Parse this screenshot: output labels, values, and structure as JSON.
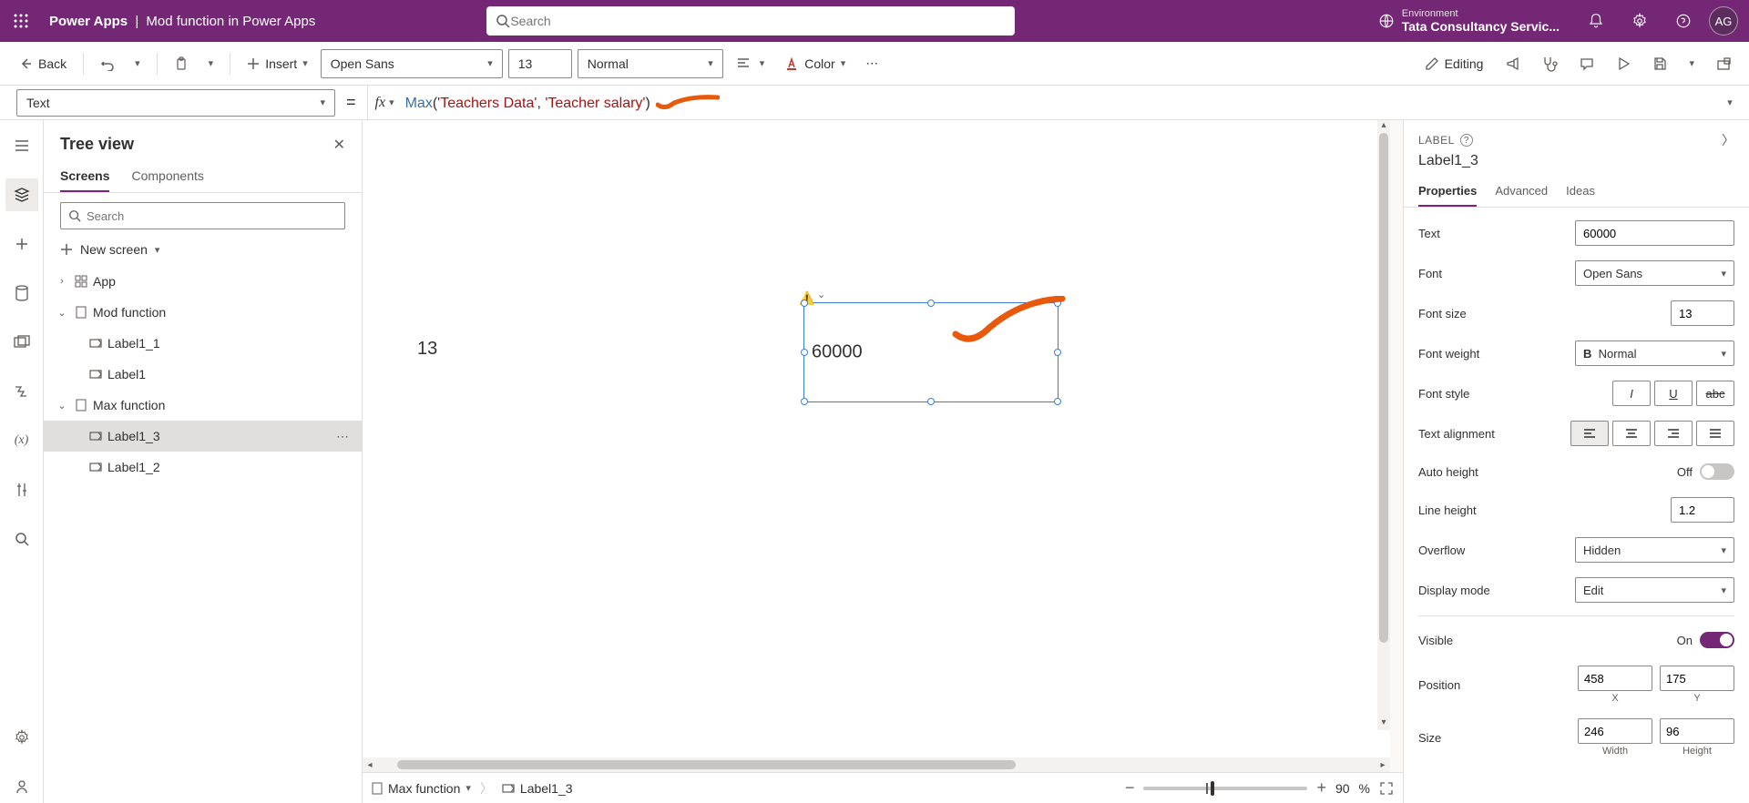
{
  "header": {
    "app_name": "Power Apps",
    "separator": "|",
    "page_title": "Mod function in Power Apps",
    "search_placeholder": "Search",
    "env_label": "Environment",
    "env_name": "Tata Consultancy Servic...",
    "avatar_initials": "AG"
  },
  "toolbar": {
    "back": "Back",
    "insert": "Insert",
    "font": "Open Sans",
    "font_size": "13",
    "font_weight": "Normal",
    "color_label": "Color",
    "editing": "Editing"
  },
  "formula": {
    "property": "Text",
    "fn": "Max",
    "arg1": "'Teachers Data'",
    "arg2": "'Teacher salary'"
  },
  "tree": {
    "title": "Tree view",
    "tab_screens": "Screens",
    "tab_components": "Components",
    "search_placeholder": "Search",
    "new_screen": "New screen",
    "nodes": {
      "app": "App",
      "mod_fn": "Mod function",
      "label1_1": "Label1_1",
      "label1": "Label1",
      "max_fn": "Max function",
      "label1_3": "Label1_3",
      "label1_2": "Label1_2"
    }
  },
  "canvas": {
    "label_13": "13",
    "sel_text": "60000",
    "bc_screen": "Max function",
    "bc_ctrl": "Label1_3",
    "zoom": "90",
    "zoom_pct": "%"
  },
  "props": {
    "type": "LABEL",
    "name": "Label1_3",
    "tab_properties": "Properties",
    "tab_advanced": "Advanced",
    "tab_ideas": "Ideas",
    "rows": {
      "text_label": "Text",
      "text_value": "60000",
      "font_label": "Font",
      "font_value": "Open Sans",
      "fontsize_label": "Font size",
      "fontsize_value": "13",
      "fontweight_label": "Font weight",
      "fontweight_value": "Normal",
      "fontstyle_label": "Font style",
      "textalign_label": "Text alignment",
      "autoheight_label": "Auto height",
      "autoheight_state": "Off",
      "lineheight_label": "Line height",
      "lineheight_value": "1.2",
      "overflow_label": "Overflow",
      "overflow_value": "Hidden",
      "displaymode_label": "Display mode",
      "displaymode_value": "Edit",
      "visible_label": "Visible",
      "visible_state": "On",
      "position_label": "Position",
      "pos_x": "458",
      "pos_y": "175",
      "pos_x_sub": "X",
      "pos_y_sub": "Y",
      "size_label": "Size",
      "size_w": "246",
      "size_h": "96",
      "size_w_sub": "Width",
      "size_h_sub": "Height"
    }
  }
}
